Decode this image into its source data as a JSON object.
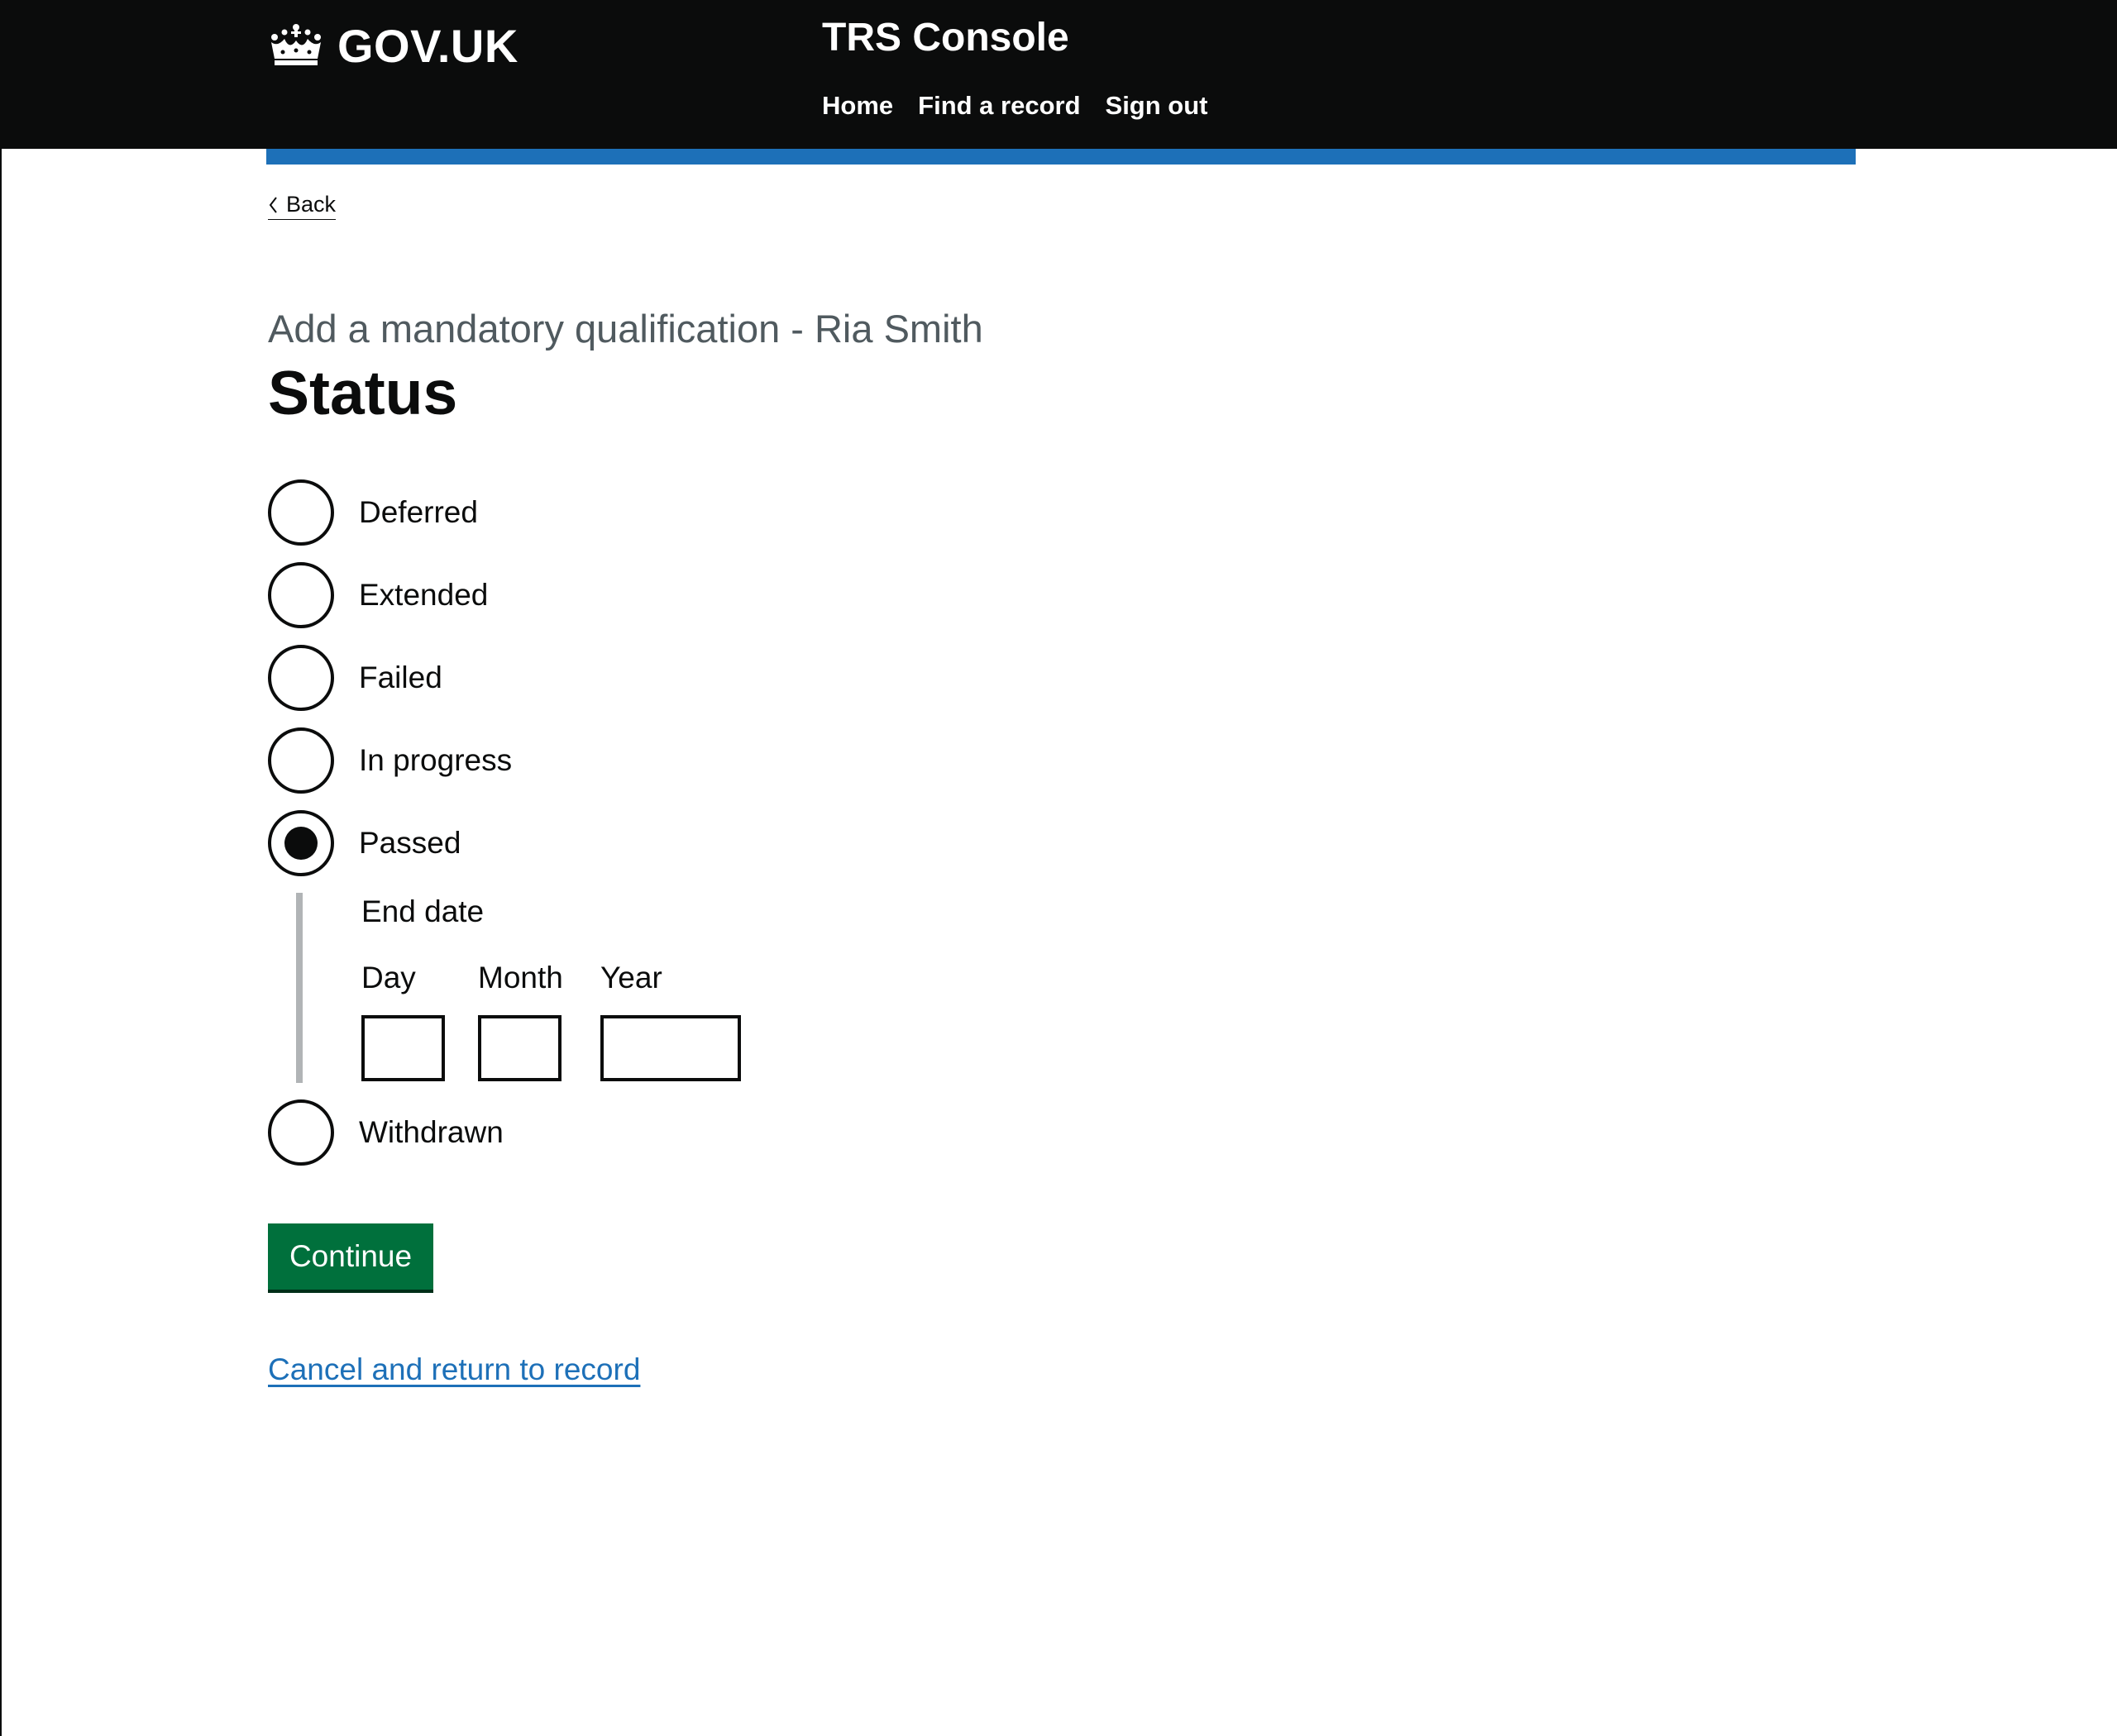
{
  "header": {
    "logo_text": "GOV.UK",
    "service_name": "TRS Console",
    "nav": [
      "Home",
      "Find a record",
      "Sign out"
    ]
  },
  "back_link": "Back",
  "caption": "Add a mandatory qualification - Ria Smith",
  "title": "Status",
  "status_options": [
    {
      "label": "Deferred",
      "checked": false
    },
    {
      "label": "Extended",
      "checked": false
    },
    {
      "label": "Failed",
      "checked": false
    },
    {
      "label": "In progress",
      "checked": false
    },
    {
      "label": "Passed",
      "checked": true
    },
    {
      "label": "Withdrawn",
      "checked": false
    }
  ],
  "end_date": {
    "legend": "End date",
    "day_label": "Day",
    "month_label": "Month",
    "year_label": "Year",
    "day_value": "",
    "month_value": "",
    "year_value": ""
  },
  "continue_label": "Continue",
  "cancel_link": "Cancel and return to record",
  "colors": {
    "header_bg": "#0b0c0c",
    "accent_blue": "#1d70b8",
    "button_green": "#00703c",
    "caption_grey": "#505a5f"
  }
}
